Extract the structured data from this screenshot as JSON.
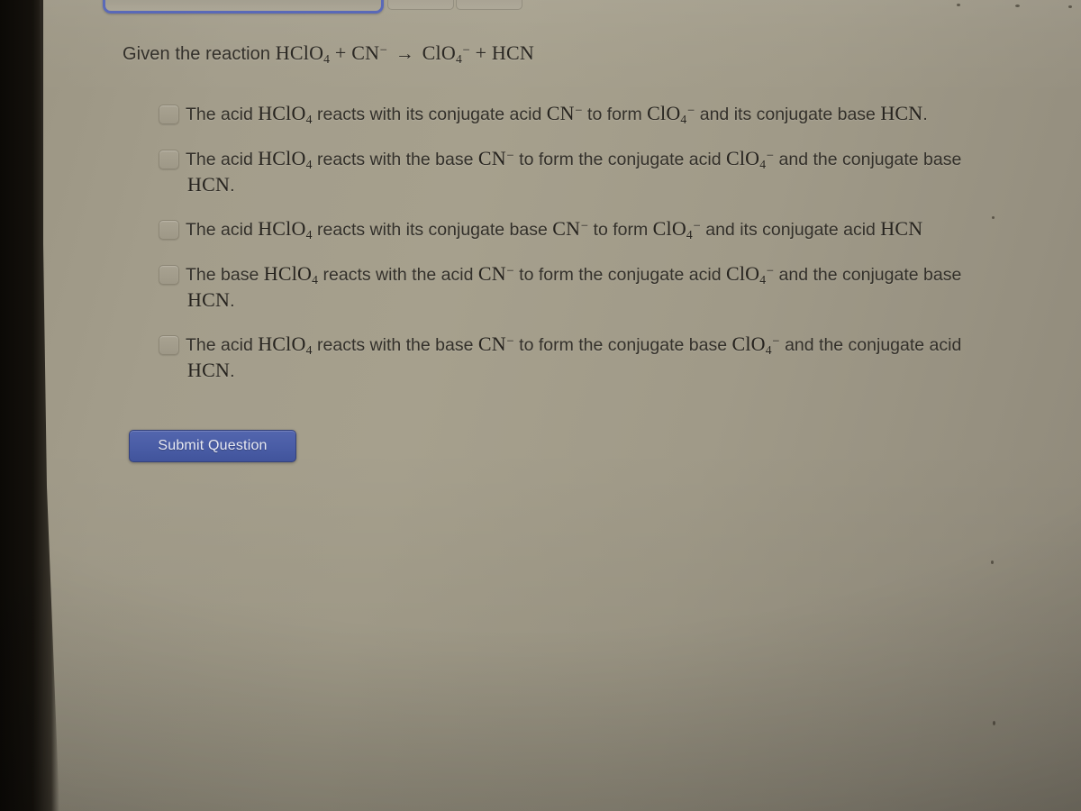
{
  "browser": {
    "tabs": [
      {
        "name": "active-tab",
        "label": ""
      },
      {
        "name": "inactive-tab-2",
        "label": ""
      },
      {
        "name": "inactive-tab-3",
        "label": ""
      }
    ]
  },
  "question": {
    "prompt_prefix": "Given the reaction",
    "equation": {
      "reactant_1": "HClO",
      "reactant_1_sub": "4",
      "plus_1": "+",
      "reactant_2": "CN",
      "reactant_2_sup": "−",
      "arrow": "→",
      "product_1": "ClO",
      "product_1_sub": "4",
      "product_1_sup": "−",
      "plus_2": "+",
      "product_2": "HCN"
    },
    "species": {
      "hclo4": "HClO",
      "hclo4_sub": "4",
      "cn": "CN",
      "cn_sup": "−",
      "clo4": "ClO",
      "clo4_sub": "4",
      "clo4_sup": "−",
      "hcn": "HCN"
    },
    "options": [
      {
        "id": "option-1",
        "checked": false,
        "lines": [
          {
            "parts": [
              {
                "type": "text",
                "value": "The acid "
              },
              {
                "type": "formula",
                "value": "hclo4"
              },
              {
                "type": "text",
                "value": " reacts with its conjugate acid "
              },
              {
                "type": "formula",
                "value": "cn"
              },
              {
                "type": "text",
                "value": " to form "
              },
              {
                "type": "formula",
                "value": "clo4"
              },
              {
                "type": "text",
                "value": " and its conjugate base "
              },
              {
                "type": "formula",
                "value": "hcn"
              },
              {
                "type": "text",
                "value": "."
              }
            ]
          }
        ],
        "plain": "The acid HClO4 reacts with its conjugate acid CN− to form ClO4− and its conjugate base HCN."
      },
      {
        "id": "option-2",
        "checked": false,
        "lines": [
          {
            "parts": [
              {
                "type": "text",
                "value": "The acid "
              },
              {
                "type": "formula",
                "value": "hclo4"
              },
              {
                "type": "text",
                "value": " reacts with the base "
              },
              {
                "type": "formula",
                "value": "cn"
              },
              {
                "type": "text",
                "value": " to form the conjugate acid "
              },
              {
                "type": "formula",
                "value": "clo4"
              },
              {
                "type": "text",
                "value": " and the conjugate base"
              }
            ]
          },
          {
            "parts": [
              {
                "type": "formula",
                "value": "hcn"
              },
              {
                "type": "text",
                "value": "."
              }
            ]
          }
        ],
        "plain": "The acid HClO4 reacts with the base CN− to form the conjugate acid ClO4− and the conjugate base HCN."
      },
      {
        "id": "option-3",
        "checked": false,
        "lines": [
          {
            "parts": [
              {
                "type": "text",
                "value": "The acid "
              },
              {
                "type": "formula",
                "value": "hclo4"
              },
              {
                "type": "text",
                "value": " reacts with its conjugate base "
              },
              {
                "type": "formula",
                "value": "cn"
              },
              {
                "type": "text",
                "value": " to form "
              },
              {
                "type": "formula",
                "value": "clo4"
              },
              {
                "type": "text",
                "value": " and its conjugate acid "
              },
              {
                "type": "formula",
                "value": "hcn"
              }
            ]
          }
        ],
        "plain": "The acid HClO4 reacts with its conjugate base CN− to form ClO4− and its conjugate acid HCN"
      },
      {
        "id": "option-4",
        "checked": false,
        "lines": [
          {
            "parts": [
              {
                "type": "text",
                "value": "The base "
              },
              {
                "type": "formula",
                "value": "hclo4"
              },
              {
                "type": "text",
                "value": " reacts with the acid "
              },
              {
                "type": "formula",
                "value": "cn"
              },
              {
                "type": "text",
                "value": " to form the conjugate acid "
              },
              {
                "type": "formula",
                "value": "clo4"
              },
              {
                "type": "text",
                "value": " and the conjugate base"
              }
            ]
          },
          {
            "parts": [
              {
                "type": "formula",
                "value": "hcn"
              },
              {
                "type": "text",
                "value": "."
              }
            ]
          }
        ],
        "plain": "The base HClO4 reacts with the acid CN− to form the conjugate acid ClO4− and the conjugate base HCN."
      },
      {
        "id": "option-5",
        "checked": false,
        "lines": [
          {
            "parts": [
              {
                "type": "text",
                "value": "The acid "
              },
              {
                "type": "formula",
                "value": "hclo4"
              },
              {
                "type": "text",
                "value": " reacts with the base "
              },
              {
                "type": "formula",
                "value": "cn"
              },
              {
                "type": "text",
                "value": " to form the conjugate base "
              },
              {
                "type": "formula",
                "value": "clo4"
              },
              {
                "type": "text",
                "value": " and the conjugate acid"
              }
            ]
          },
          {
            "parts": [
              {
                "type": "formula",
                "value": "hcn"
              },
              {
                "type": "text",
                "value": "."
              }
            ]
          }
        ],
        "plain": "The acid HClO4 reacts with the base CN− to form the conjugate base ClO4− and the conjugate acid HCN."
      }
    ]
  },
  "actions": {
    "submit_label": "Submit Question"
  },
  "colors": {
    "submit_button": "#4a5da6",
    "active_tab_outline": "#5161b4",
    "page_background": "#a39d8b",
    "text": "#33302a"
  }
}
